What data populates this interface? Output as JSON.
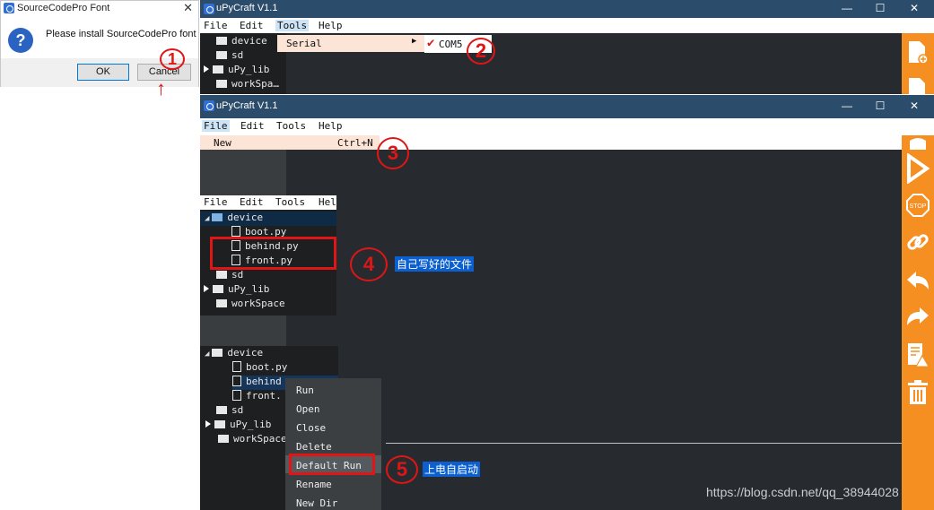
{
  "dialog": {
    "title": "SourceCodePro Font",
    "close": "✕",
    "message": "Please install SourceCodePro font",
    "ok_label": "OK",
    "cancel_label": "Cancel",
    "question_glyph": "?"
  },
  "window1": {
    "title": "uPyCraft V1.1",
    "controls": [
      "—",
      "☐",
      "✕"
    ],
    "menu": [
      "File",
      "Edit",
      "Tools",
      "Help"
    ],
    "submenu_item": "Serial",
    "port": "COM5",
    "check": "✔",
    "tree": [
      "device",
      "sd",
      "uPy_lib",
      "workSpa…"
    ]
  },
  "window2": {
    "title": "uPyCraft V1.1",
    "controls": [
      "—",
      "☐",
      "✕"
    ],
    "menu": [
      "File",
      "Edit",
      "Tools",
      "Help"
    ],
    "file_menu_item": "New",
    "file_menu_shortcut": "Ctrl+N"
  },
  "panel3": {
    "menu": [
      "File",
      "Edit",
      "Tools",
      "Help"
    ],
    "tree": [
      "device",
      "boot.py",
      "behind.py",
      "front.py",
      "sd",
      "uPy_lib",
      "workSpace"
    ]
  },
  "panel4": {
    "tree": [
      "device",
      "boot.py",
      "behind",
      "front.",
      "sd",
      "uPy_lib",
      "workSpace"
    ],
    "context_menu": [
      "Run",
      "Open",
      "Close",
      "Delete",
      "Default Run",
      "Rename",
      "New Dir"
    ]
  },
  "annotations": {
    "step1": "1",
    "step2": "2",
    "step3": "3",
    "step4": "4",
    "step5": "5",
    "label4": "自己写好的文件",
    "label5": "上电自启动",
    "arrow": "↑"
  },
  "watermark": "https://blog.csdn.net/qq_38944028",
  "colors": {
    "titlebar": "#2b4c6a",
    "editor": "#272b30",
    "tree": "#1d1f21",
    "sidebar": "#f68f22",
    "annotation_red": "#e01515",
    "label_blue": "#0b5fcf"
  },
  "sidebar_icons": [
    "new-file-icon",
    "save-icon",
    "download-run-icon",
    "stop-icon",
    "connect-icon",
    "undo-icon",
    "redo-icon",
    "syntax-check-icon",
    "clear-icon"
  ]
}
